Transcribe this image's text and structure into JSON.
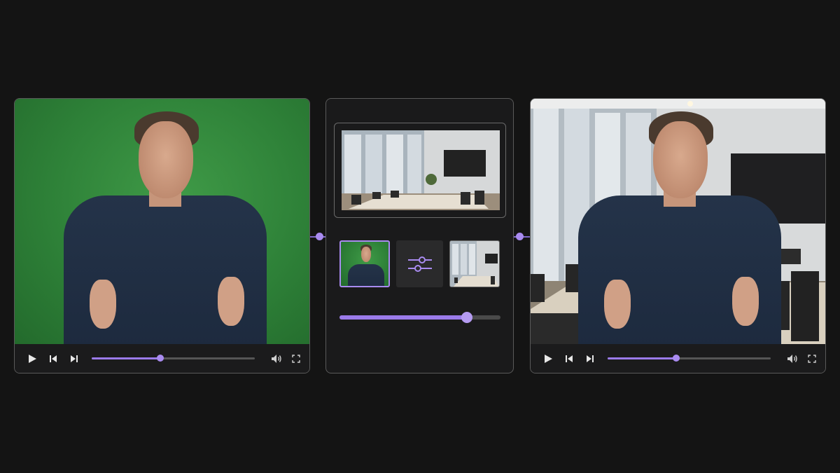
{
  "left_player": {
    "background": "green-screen",
    "progress_fraction": 0.42,
    "controls": [
      "play-icon",
      "skip-back-icon",
      "skip-forward-icon",
      "volume-icon",
      "fullscreen-icon"
    ]
  },
  "center_panel": {
    "preview": "office-background",
    "thumbnails": [
      "green-screen-person",
      "adjustments-icon",
      "office-background"
    ],
    "blend_slider_fraction": 0.79
  },
  "right_player": {
    "background": "office-composite",
    "progress_fraction": 0.42,
    "controls": [
      "play-icon",
      "skip-back-icon",
      "skip-forward-icon",
      "volume-icon",
      "fullscreen-icon"
    ]
  },
  "colors": {
    "accent": "#9b7bea",
    "page_background": "#141414",
    "panel_border": "#5a5a5a",
    "green_screen": "#2e8138"
  }
}
